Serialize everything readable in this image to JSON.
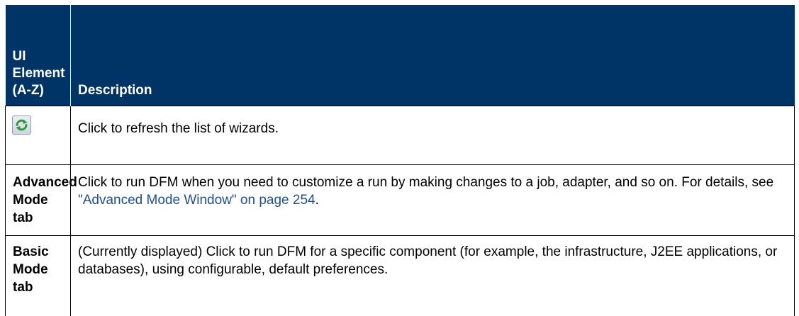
{
  "table": {
    "header": {
      "col1_line1": "UI",
      "col1_line2": "Element",
      "col1_line3": "(A-Z)",
      "col2": "Description"
    },
    "rows": [
      {
        "element_icon": "refresh-icon",
        "description": "Click to refresh the list of wizards."
      },
      {
        "element_line1": "Advanced",
        "element_line2": "Mode tab",
        "description_before": "Click to run DFM when you need to customize a run by making changes to a job, adapter, and so on. For details, see ",
        "description_link": "\"Advanced Mode Window\" on page 254",
        "description_after": "."
      },
      {
        "element_line1": "Basic",
        "element_line2": "Mode tab",
        "description": "(Currently displayed) Click to run DFM for a specific component (for example, the infrastructure, J2EE applications, or databases), using configurable, default preferences."
      }
    ]
  },
  "colors": {
    "header_bg": "#003366",
    "header_text": "#ffffff",
    "link": "#1f4e99"
  }
}
